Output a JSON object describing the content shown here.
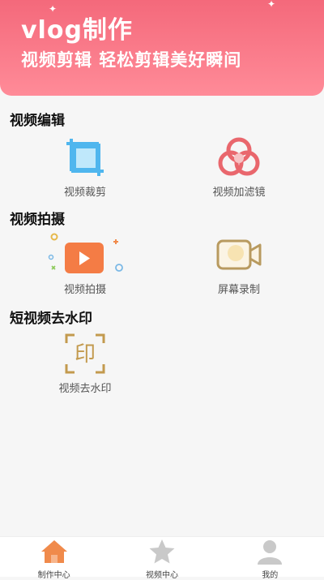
{
  "banner": {
    "title": "vlog制作",
    "subtitle": "视频剪辑   轻松剪辑美好瞬间",
    "gradient_top": "#f4697b",
    "gradient_bottom": "#ff8b98"
  },
  "sections": [
    {
      "title": "视频编辑",
      "tools": [
        {
          "label": "视频裁剪",
          "icon": "crop-icon"
        },
        {
          "label": "视频加滤镜",
          "icon": "filter-icon"
        }
      ]
    },
    {
      "title": "视频拍摄",
      "tools": [
        {
          "label": "视频拍摄",
          "icon": "video-camera-play-icon"
        },
        {
          "label": "屏幕录制",
          "icon": "screen-record-icon"
        }
      ]
    },
    {
      "title": "短视频去水印",
      "tools": [
        {
          "label": "视频去水印",
          "icon": "remove-watermark-icon",
          "icon_glyph": "印"
        }
      ]
    }
  ],
  "tabbar": {
    "tabs": [
      {
        "label": "制作中心",
        "icon": "home-icon",
        "active": true
      },
      {
        "label": "视频中心",
        "icon": "star-icon",
        "active": false
      },
      {
        "label": "我的",
        "icon": "user-icon",
        "active": false
      }
    ],
    "active_color": "#f08a4b",
    "inactive_color": "#c9c9c9"
  }
}
